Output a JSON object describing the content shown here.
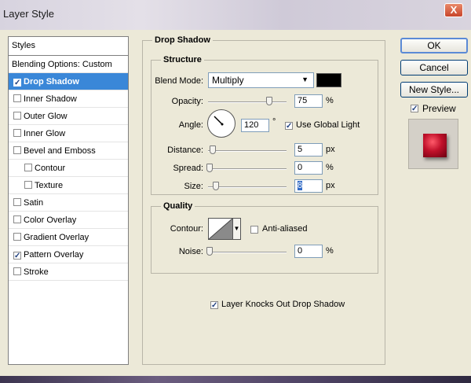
{
  "window": {
    "title": "Layer Style",
    "close_glyph": "X"
  },
  "styles": {
    "header": "Styles",
    "items": [
      {
        "label": "Blending Options: Custom",
        "checked": null
      },
      {
        "label": "Drop Shadow",
        "checked": true,
        "selected": true
      },
      {
        "label": "Inner Shadow",
        "checked": false
      },
      {
        "label": "Outer Glow",
        "checked": false
      },
      {
        "label": "Inner Glow",
        "checked": false
      },
      {
        "label": "Bevel and Emboss",
        "checked": false
      },
      {
        "label": "Contour",
        "checked": false,
        "indent": true
      },
      {
        "label": "Texture",
        "checked": false,
        "indent": true
      },
      {
        "label": "Satin",
        "checked": false
      },
      {
        "label": "Color Overlay",
        "checked": false
      },
      {
        "label": "Gradient Overlay",
        "checked": false
      },
      {
        "label": "Pattern Overlay",
        "checked": true
      },
      {
        "label": "Stroke",
        "checked": false
      }
    ]
  },
  "drop_shadow": {
    "title": "Drop Shadow",
    "structure": {
      "title": "Structure",
      "blend_mode_label": "Blend Mode:",
      "blend_mode_value": "Multiply",
      "shadow_color": "#000000",
      "opacity_label": "Opacity:",
      "opacity_value": "75",
      "opacity_unit": "%",
      "angle_label": "Angle:",
      "angle_value": "120",
      "angle_unit": "°",
      "use_global_light_label": "Use Global Light",
      "use_global_light_checked": true,
      "distance_label": "Distance:",
      "distance_value": "5",
      "distance_unit": "px",
      "spread_label": "Spread:",
      "spread_value": "0",
      "spread_unit": "%",
      "size_label": "Size:",
      "size_value": "8",
      "size_unit": "px"
    },
    "quality": {
      "title": "Quality",
      "contour_label": "Contour:",
      "anti_aliased_label": "Anti-aliased",
      "anti_aliased_checked": false,
      "noise_label": "Noise:",
      "noise_value": "0",
      "noise_unit": "%"
    },
    "knockout_label": "Layer Knocks Out Drop Shadow",
    "knockout_checked": true
  },
  "buttons": {
    "ok": "OK",
    "cancel": "Cancel",
    "new_style": "New Style...",
    "preview_label": "Preview",
    "preview_checked": true
  },
  "colors": {
    "selection": "#3a87d8",
    "dialog_bg": "#ece9d8"
  }
}
